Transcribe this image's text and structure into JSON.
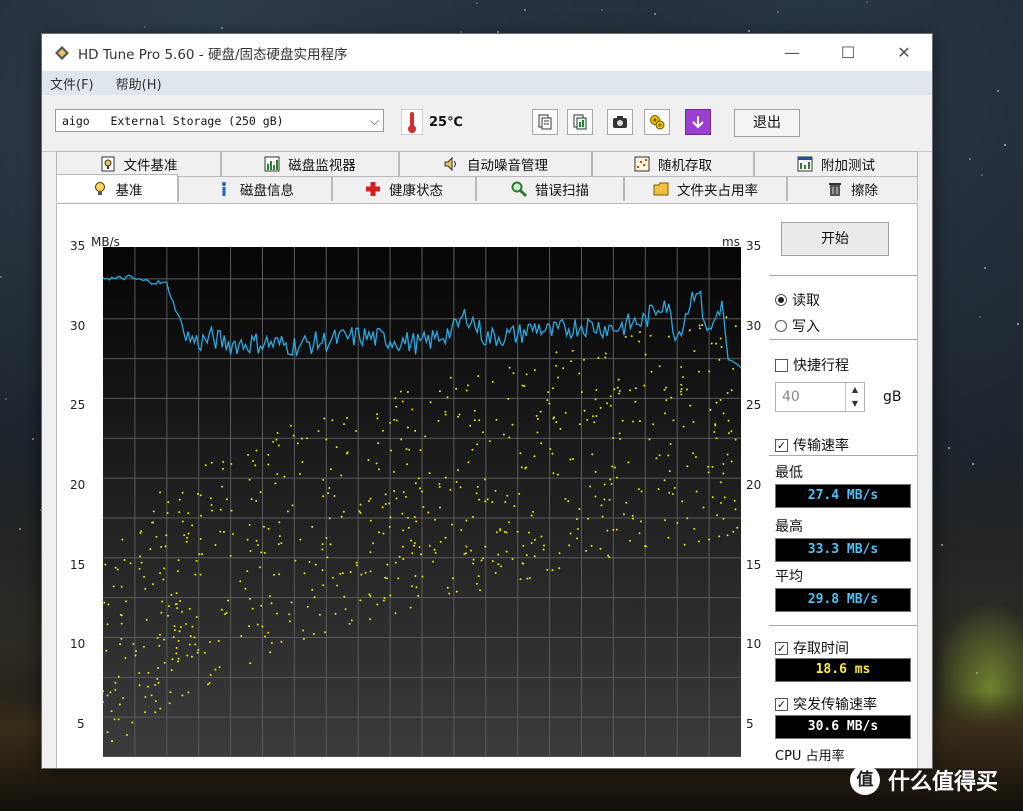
{
  "window": {
    "title": "HD Tune Pro 5.60 - 硬盘/固态硬盘实用程序",
    "controls": {
      "minimize": "—",
      "maximize": "☐",
      "close": "✕"
    }
  },
  "menu": [
    "文件(F)",
    "帮助(H)"
  ],
  "toolbar": {
    "drive": "aigo   External Storage (250 gB)",
    "temperature": "25℃",
    "exit_label": "退出",
    "icons": [
      "copy-text-icon",
      "copy-info-icon",
      "screenshot-camera-icon",
      "options-icon",
      "save-download-icon"
    ]
  },
  "tabs": {
    "row1": [
      {
        "label": "文件基准",
        "icon": "file-benchmark-icon"
      },
      {
        "label": "磁盘监视器",
        "icon": "disk-monitor-icon"
      },
      {
        "label": "自动噪音管理",
        "icon": "speaker-icon"
      },
      {
        "label": "随机存取",
        "icon": "random-access-icon"
      },
      {
        "label": "附加测试",
        "icon": "extra-tests-icon"
      }
    ],
    "row2": [
      {
        "label": "基准",
        "icon": "bulb-icon",
        "active": true
      },
      {
        "label": "磁盘信息",
        "icon": "info-icon"
      },
      {
        "label": "健康状态",
        "icon": "health-cross-icon"
      },
      {
        "label": "错误扫描",
        "icon": "magnifier-icon"
      },
      {
        "label": "文件夹占用率",
        "icon": "folder-icon"
      },
      {
        "label": "擦除",
        "icon": "trash-icon"
      }
    ]
  },
  "chart_data": {
    "type": "line",
    "left_axis_unit": "MB/s",
    "right_axis_unit": "ms",
    "yticks_left": [
      35,
      30,
      25,
      20,
      15,
      10,
      5
    ],
    "yticks_right": [
      35,
      30,
      25,
      20,
      15,
      10,
      5
    ],
    "ylim": [
      3,
      35
    ],
    "grid": true,
    "series": [
      {
        "kind": "transfer_rate",
        "color": "#29a9e1",
        "x": [
          0,
          2,
          4,
          6,
          8,
          10,
          11,
          12,
          13,
          15,
          17,
          20,
          25,
          30,
          35,
          40,
          45,
          50,
          55,
          57,
          60,
          65,
          68,
          70,
          75,
          80,
          85,
          88,
          90,
          93,
          95,
          97,
          98,
          100
        ],
        "values": [
          33.1,
          33.0,
          33.1,
          32.9,
          32.8,
          32.7,
          31.5,
          30.5,
          29.4,
          29.0,
          29.3,
          28.9,
          29.0,
          28.8,
          29.1,
          29.4,
          29.2,
          28.9,
          29.8,
          30.8,
          29.3,
          29.5,
          30.0,
          29.6,
          30.1,
          29.9,
          30.4,
          31.7,
          29.4,
          32.6,
          29.5,
          31.6,
          27.9,
          27.4
        ]
      },
      {
        "kind": "access_time_scatter",
        "color": "#e4e400"
      }
    ]
  },
  "panel": {
    "start_label": "开始",
    "read_label": "读取",
    "write_label": "写入",
    "mode": "read",
    "short_stroke_label": "快捷行程",
    "short_stroke_checked": false,
    "short_stroke_value": "40",
    "short_stroke_unit": "gB",
    "transfer_label": "传输速率",
    "min_label": "最低",
    "min_value": "27.4 MB/s",
    "max_label": "最高",
    "max_value": "33.3 MB/s",
    "avg_label": "平均",
    "avg_value": "29.8 MB/s",
    "access_label": "存取时间",
    "access_value": "18.6 ms",
    "burst_label": "突发传输速率",
    "burst_value": "30.6 MB/s",
    "cpu_label": "CPU 占用率"
  },
  "watermark": {
    "logo_char": "值",
    "text": "什么值得买"
  }
}
